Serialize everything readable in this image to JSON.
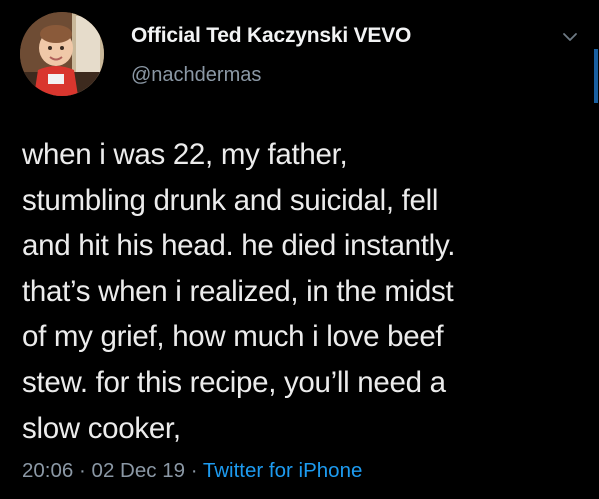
{
  "tweet": {
    "author": {
      "display_name": "Official Ted Kaczynski VEVO",
      "handle": "@nachdermas",
      "avatar_icon": "profile-photo-child"
    },
    "text_lines": [
      "when i was 22, my father,",
      "stumbling drunk and suicidal, fell",
      "and hit his head. he died instantly.",
      "that’s when i realized, in the midst",
      "of my grief, how much i love beef",
      "stew. for this recipe, you’ll need a",
      "slow cooker,"
    ],
    "time": "20:06",
    "date": "02 Dec 19",
    "separator": "·",
    "source": "Twitter for iPhone"
  },
  "menu": {
    "icon": "chevron-down-icon"
  },
  "colors": {
    "background": "#000000",
    "text": "#ececec",
    "secondary": "#8b98a5",
    "link": "#1d9bf0"
  }
}
